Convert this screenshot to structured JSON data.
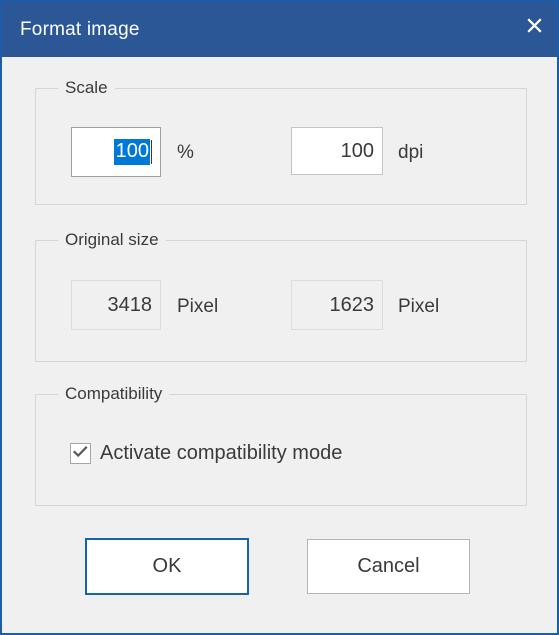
{
  "window": {
    "title": "Format image",
    "close_icon": "close-icon",
    "accent_color": "#2b5797",
    "border_color": "#1c5ca8",
    "background_color": "#f0f0f0"
  },
  "groups": {
    "scale": {
      "label": "Scale",
      "percent_field": {
        "value": "100",
        "unit": "%",
        "selected": true,
        "selection_color": "#0078d7"
      },
      "dpi_field": {
        "value": "100",
        "unit": "dpi",
        "selected": false
      }
    },
    "original_size": {
      "label": "Original size",
      "width_field": {
        "value": "3418",
        "unit": "Pixel"
      },
      "height_field": {
        "value": "1623",
        "unit": "Pixel"
      }
    },
    "compatibility": {
      "label": "Compatibility",
      "checkbox": {
        "label": "Activate compatibility mode",
        "checked": true,
        "icon": "check-icon"
      }
    }
  },
  "footer": {
    "ok_label": "OK",
    "cancel_label": "Cancel"
  }
}
